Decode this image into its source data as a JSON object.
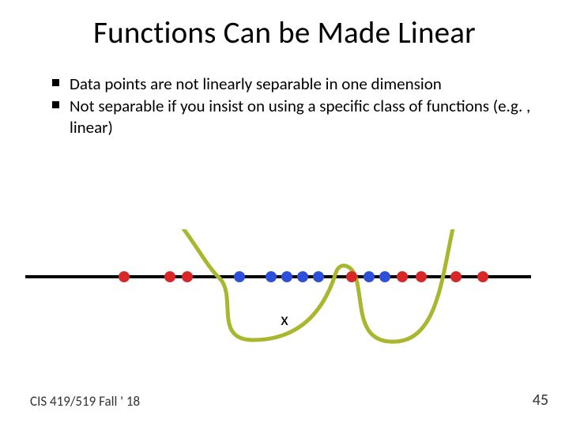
{
  "title": "Functions Can be Made Linear",
  "bullets": [
    "Data points are not linearly separable in one dimension",
    "Not separable if you insist on using a specific class of functions (e.g. , linear)"
  ],
  "axis_label": "x",
  "footer_left": "CIS 419/519 Fall ' 18",
  "footer_right": "45",
  "chart_data": {
    "type": "scatter",
    "title": "",
    "xlabel": "x",
    "ylabel": "",
    "series": [
      {
        "name": "red",
        "color": "#d92626",
        "x": [
          150,
          208,
          230,
          438,
          502,
          526,
          570,
          604
        ],
        "y": [
          0,
          0,
          0,
          0,
          0,
          0,
          0,
          0
        ]
      },
      {
        "name": "blue",
        "color": "#2e4fd9",
        "x": [
          296,
          336,
          356,
          376,
          396,
          460,
          480
        ],
        "y": [
          0,
          0,
          0,
          0,
          0,
          0,
          0
        ]
      }
    ],
    "xlim": [
      32,
      672
    ],
    "ylim": [
      0,
      0
    ],
    "curve_note": "hand-drawn loop encircling the blue cluster"
  }
}
